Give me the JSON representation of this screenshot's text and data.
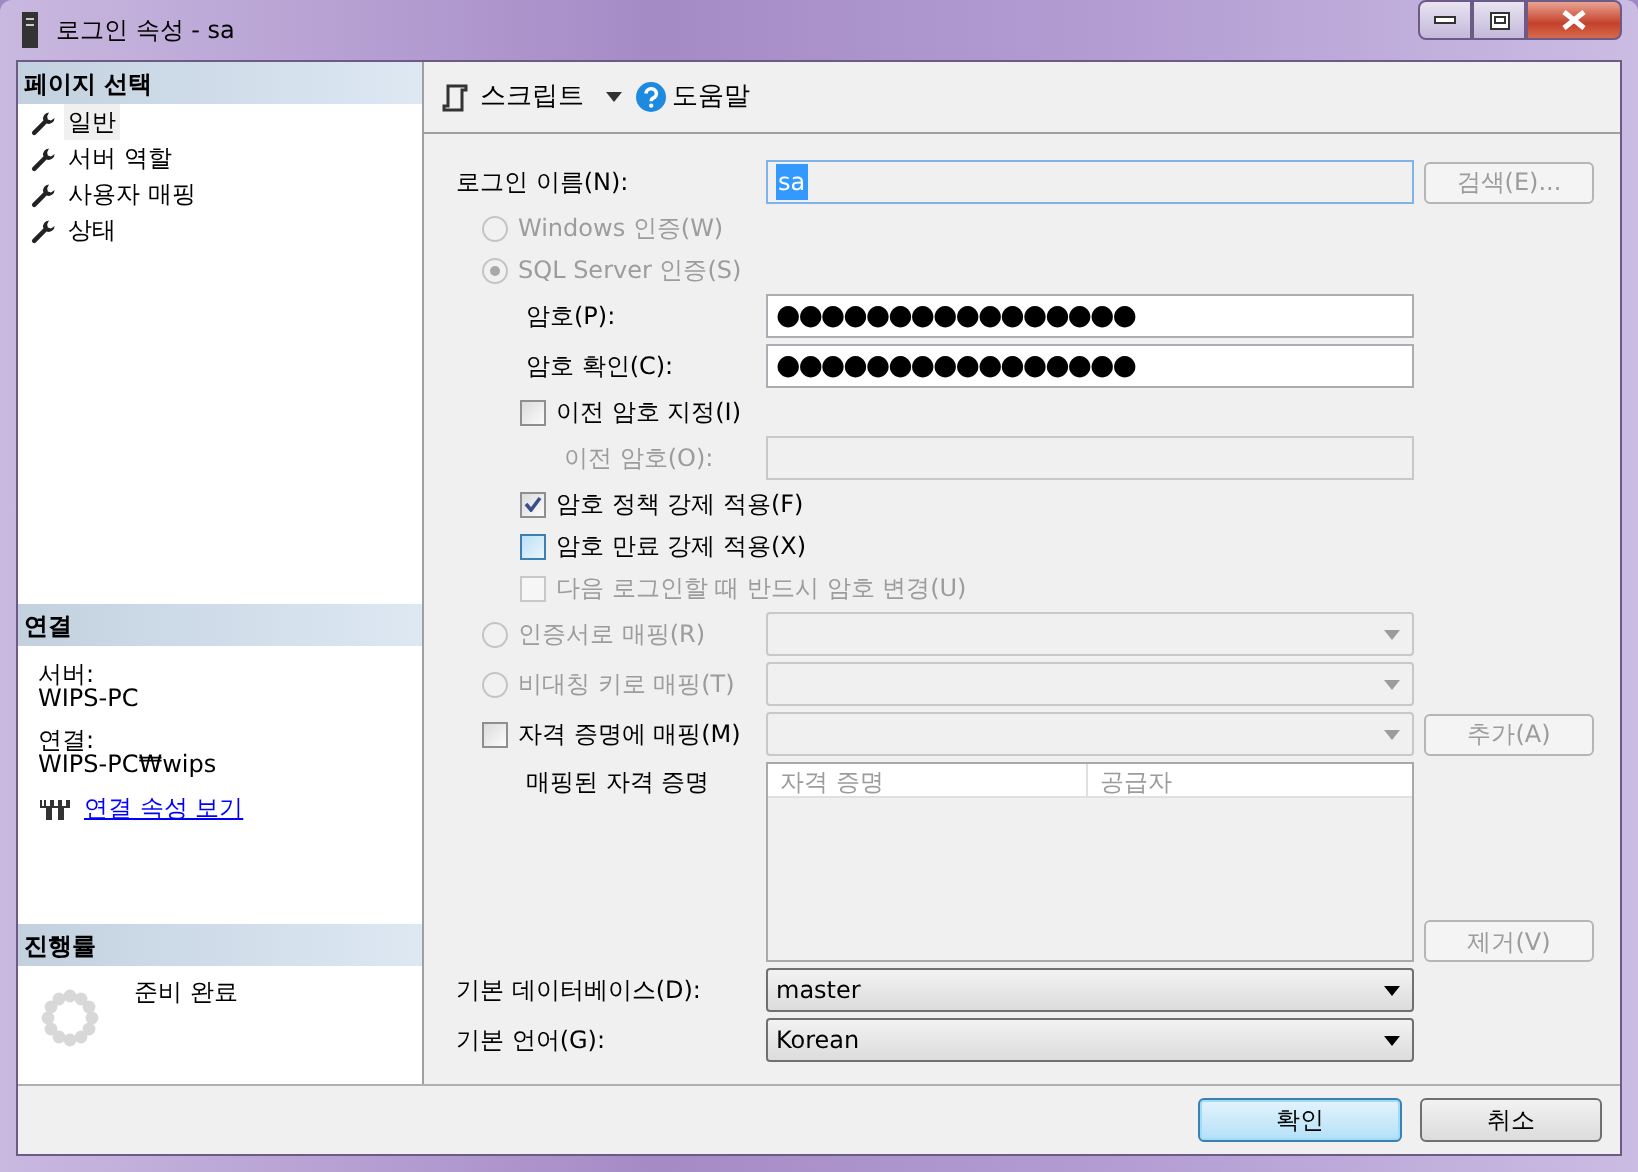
{
  "window": {
    "title": "로그인 속성 - sa"
  },
  "sidebar": {
    "header": "페이지 선택",
    "items": [
      {
        "label": "일반",
        "selected": true
      },
      {
        "label": "서버 역할",
        "selected": false
      },
      {
        "label": "사용자 매핑",
        "selected": false
      },
      {
        "label": "상태",
        "selected": false
      }
    ]
  },
  "connection": {
    "header": "연결",
    "server_label": "서버:",
    "server": "WIPS-PC",
    "connection_label": "연결:",
    "connection": "WIPS-PC₩wips",
    "link": "연결 속성 보기"
  },
  "progress": {
    "header": "진행률",
    "status": "준비 완료"
  },
  "toolbar": {
    "script": "스크립트",
    "help": "도움말"
  },
  "form": [
    {
      "kind": "field",
      "label": "로그인 이름(N):",
      "value": "sa",
      "disabled": true,
      "button": "검색(E)..."
    },
    {
      "kind": "radio",
      "label": "Windows 인증(W)",
      "selected": false,
      "disabled": true
    },
    {
      "kind": "radio",
      "label": "SQL Server 인증(S)",
      "selected": true,
      "disabled": true
    },
    {
      "kind": "subfield",
      "label": "암호(P):",
      "value": "●●●●●●●●●●●●●●●●",
      "disabled": false
    },
    {
      "kind": "subfield",
      "label": "암호 확인(C):",
      "value": "●●●●●●●●●●●●●●●●",
      "disabled": false
    },
    {
      "kind": "checkbox",
      "label": "이전 암호 지정(I)",
      "checked": false,
      "disabled": false,
      "hover": false
    },
    {
      "kind": "subsubfield",
      "label": "이전 암호(O):",
      "disabled": true
    },
    {
      "kind": "checkbox",
      "label": "암호 정책 강제 적용(F)",
      "checked": true,
      "disabled": false,
      "hover": false
    },
    {
      "kind": "checkbox",
      "label": "암호 만료 강제 적용(X)",
      "checked": false,
      "disabled": false,
      "hover": true
    },
    {
      "kind": "checkbox",
      "label": "다음 로그인할 때 반드시 암호 변경(U)",
      "checked": false,
      "disabled": true,
      "hover": false
    },
    {
      "kind": "radio-combo",
      "label": "인증서로 매핑(R)",
      "selected": false,
      "disabled": true
    },
    {
      "kind": "radio-combo",
      "label": "비대칭 키로 매핑(T)",
      "selected": false,
      "disabled": true
    },
    {
      "kind": "check-combo",
      "label": "자격 증명에 매핑(M)",
      "checked": false,
      "disabled": false,
      "button": "추가(A)"
    },
    {
      "kind": "list",
      "label": "매핑된 자격 증명",
      "columns": [
        "자격 증명",
        "공급자"
      ],
      "button": "제거(V)"
    },
    {
      "kind": "combo",
      "label": "기본 데이터베이스(D):",
      "value": "master"
    },
    {
      "kind": "combo",
      "label": "기본 언어(G):",
      "value": "Korean"
    }
  ],
  "buttons": [
    {
      "label": "확인",
      "default": true
    },
    {
      "label": "취소",
      "default": false
    }
  ]
}
